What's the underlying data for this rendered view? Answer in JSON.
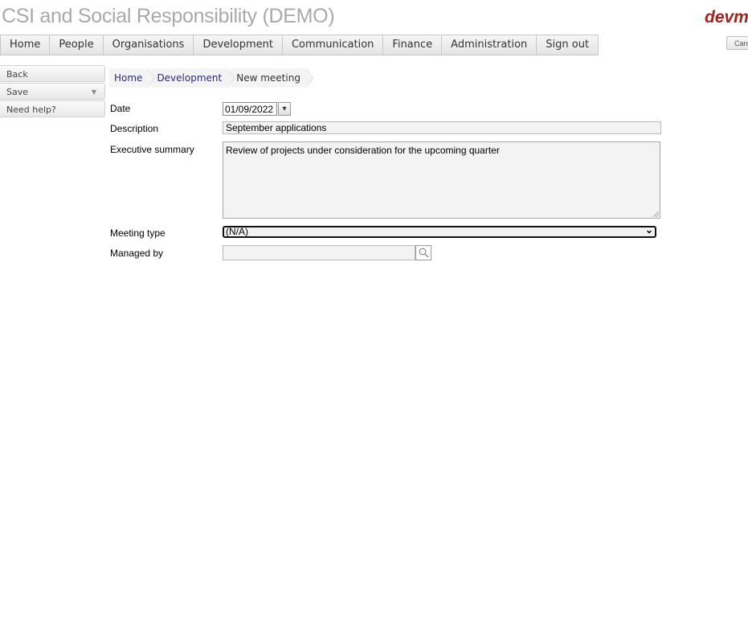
{
  "header": {
    "title": "CSI and Social Responsibility (DEMO)",
    "logo_text": "devm",
    "corner_button": "Card"
  },
  "menu": {
    "items": [
      {
        "label": "Home"
      },
      {
        "label": "People"
      },
      {
        "label": "Organisations"
      },
      {
        "label": "Development"
      },
      {
        "label": "Communication"
      },
      {
        "label": "Finance"
      },
      {
        "label": "Administration"
      },
      {
        "label": "Sign out"
      }
    ]
  },
  "actions": {
    "back": "Back",
    "save": "Save",
    "help": "Need help?"
  },
  "breadcrumb": {
    "items": [
      {
        "label": "Home"
      },
      {
        "label": "Development"
      },
      {
        "label": "New meeting"
      }
    ]
  },
  "form": {
    "date": {
      "label": "Date",
      "value": "01/09/2022"
    },
    "description": {
      "label": "Description",
      "value": "September applications"
    },
    "executive_summary": {
      "label": "Executive summary",
      "value": "Review of projects under consideration for the upcoming quarter"
    },
    "meeting_type": {
      "label": "Meeting type",
      "value": "(N/A)"
    },
    "managed_by": {
      "label": "Managed by",
      "value": ""
    }
  },
  "icons": {
    "dropdown": "chevron-down-icon",
    "search": "search-icon",
    "resize": "resize-grip-icon"
  }
}
